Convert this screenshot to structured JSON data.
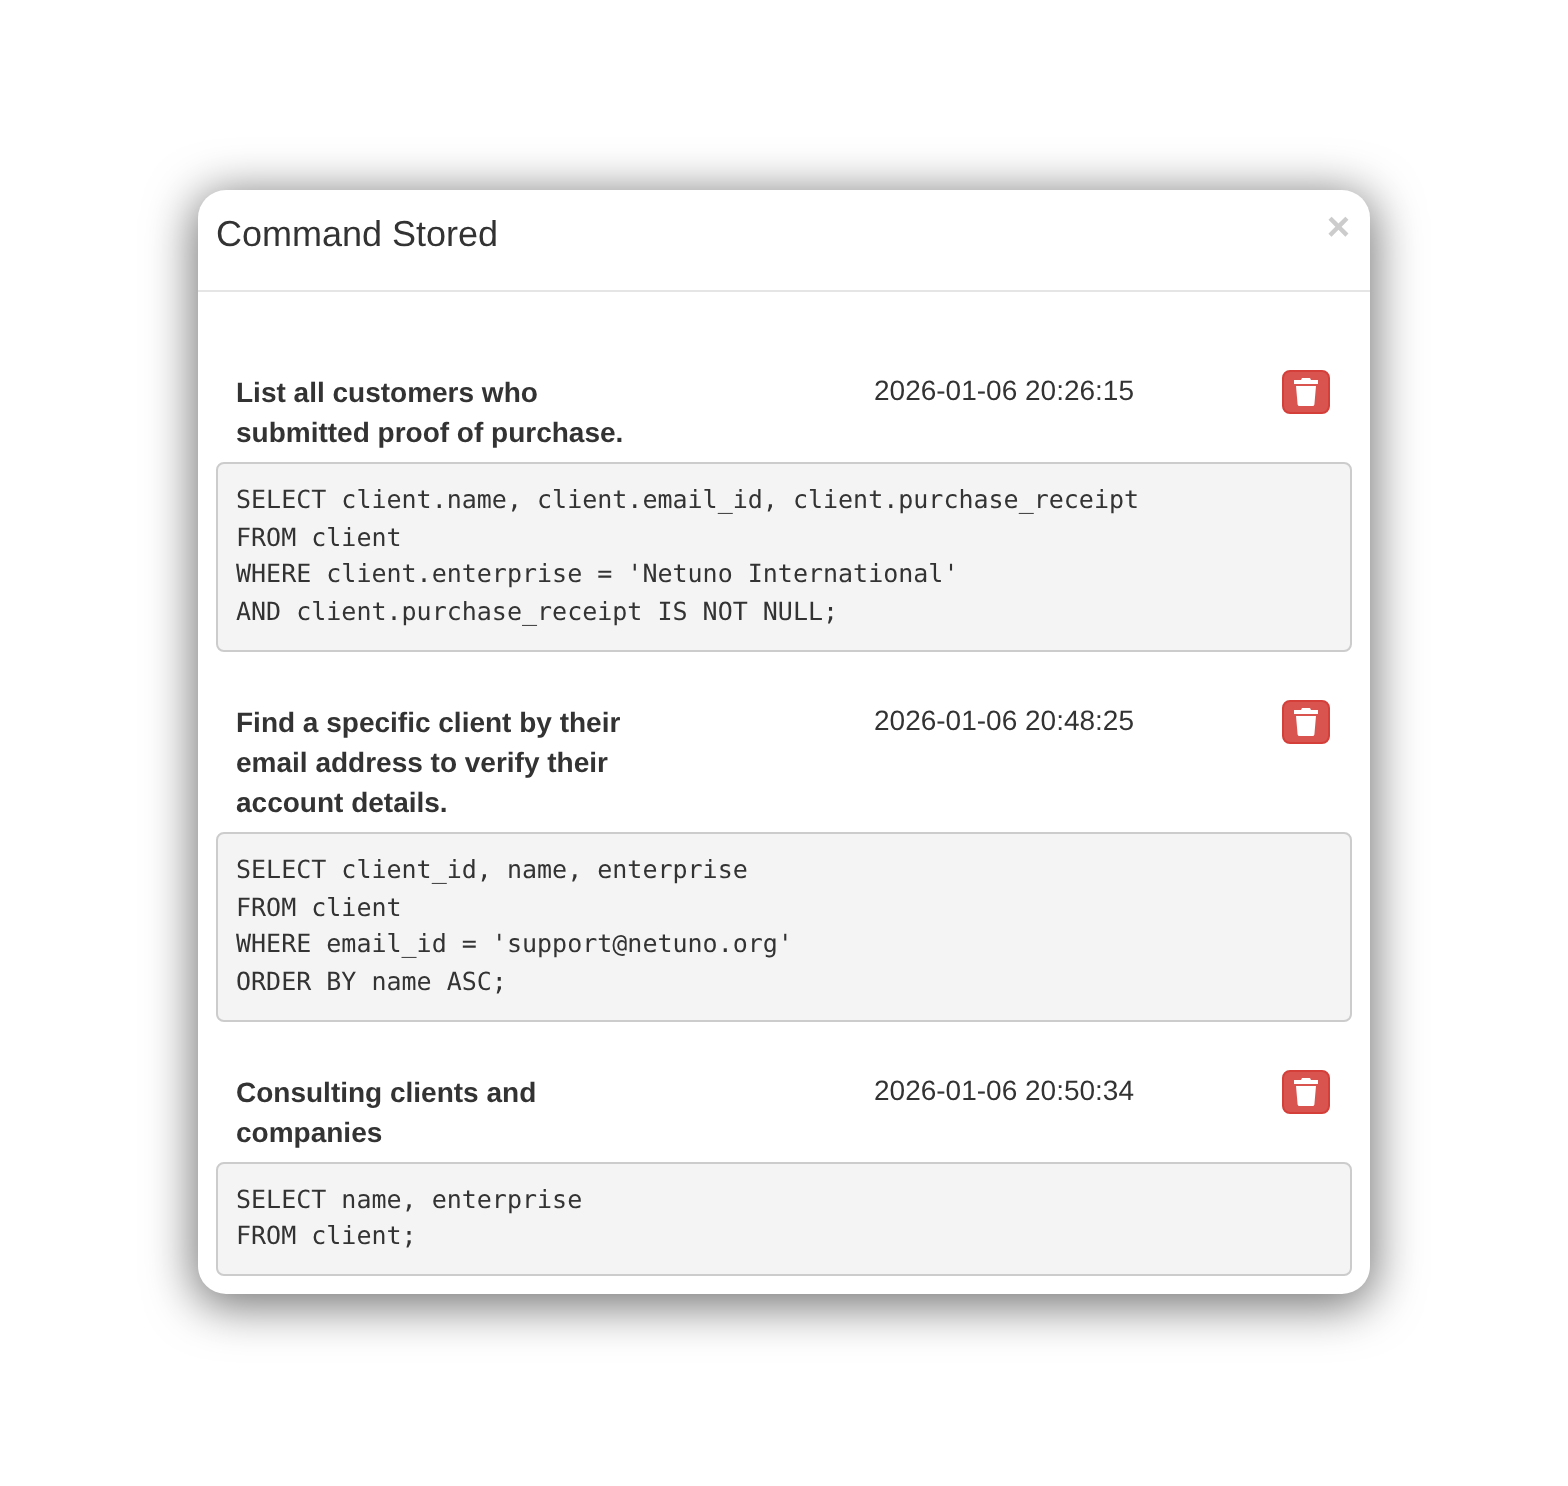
{
  "dialog": {
    "title": "Command Stored",
    "close": "×"
  },
  "commands": [
    {
      "description": "List all customers who submitted proof of purchase.",
      "timestamp": "2026-01-06 20:26:15",
      "code": "SELECT client.name, client.email_id, client.purchase_receipt\nFROM client\nWHERE client.enterprise = 'Netuno International'\nAND client.purchase_receipt IS NOT NULL;"
    },
    {
      "description": "Find a specific client by their email address to verify their account details.",
      "timestamp": "2026-01-06 20:48:25",
      "code": "SELECT client_id, name, enterprise\nFROM client\nWHERE email_id = 'support@netuno.org'\nORDER BY name ASC;"
    },
    {
      "description": "Consulting clients and companies",
      "timestamp": "2026-01-06 20:50:34",
      "code": "SELECT name, enterprise\nFROM client;"
    }
  ]
}
